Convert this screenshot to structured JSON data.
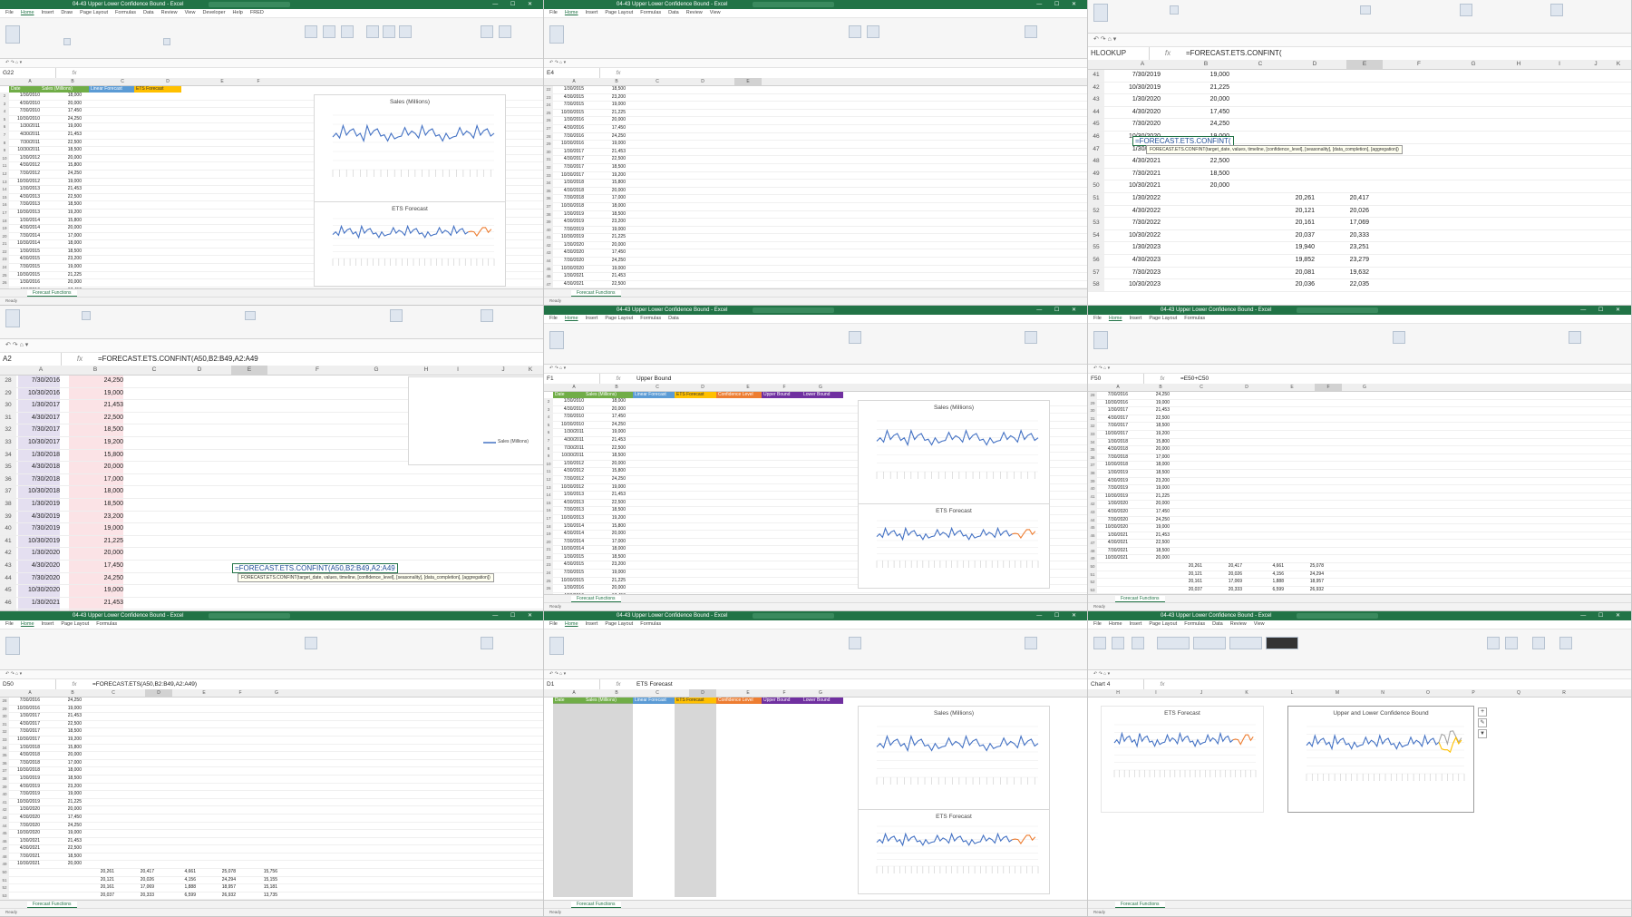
{
  "app": {
    "title": "04-43 Upper Lower Confidence Bound - Excel",
    "menu": [
      "File",
      "Home",
      "Insert",
      "Draw",
      "Page Layout",
      "Formulas",
      "Data",
      "Review",
      "View",
      "Developer",
      "Help",
      "FRED"
    ],
    "share_label": "Share",
    "sheet_tab": "Forecast Functions",
    "accent": "#217346"
  },
  "headers": {
    "date": "Date",
    "sales": "Sales (Millions)",
    "linear": "Linear Forecast",
    "ets": "ETS Forecast",
    "conf": "Confidence Level",
    "upper": "Upper Bound",
    "lower": "Lower Bound",
    "colors": {
      "date": "#70ad47",
      "sales": "#70ad47",
      "linear": "#5b9bd5",
      "ets": "#ffc000",
      "conf": "#ed7d31",
      "upper": "#7030a0",
      "lower": "#7030a0"
    }
  },
  "charts": {
    "sales_title": "Sales (Millions)",
    "ets_title": "ETS Forecast",
    "bound_title": "Upper and Lower Confidence Bound",
    "ets_title2": "ETS Forecast",
    "legend_sales": "Sales (Millions)"
  },
  "formulas": {
    "p3_namebox": "HLOOKUP",
    "p3_formula": "=FORECAST.ETS.CONFINT(",
    "p3_tooltip": "FORECAST.ETS.CONFINT(target_date, values, timeline, [confidence_level], [seasonality], [data_completion], [aggregation])",
    "p4_namebox": "A2",
    "p4_formula": "=FORECAST.ETS.CONFINT(A50,B2:B49,A2:A49",
    "p4_edit": "=FORECAST.ETS.CONFINT(A50,B2:B49,A2:A49",
    "p4_tooltip": "FORECAST.ETS.CONFINT(target_date, values, timeline, [confidence_level], [seasonality], [data_completion], [aggregation])",
    "p7_formula": "=FORECAST.ETS(A50,B2:B49,A2:A49)",
    "p8_formula": "ETS Forecast",
    "p6_formula": "=E50+C50",
    "p5_formula": "Upper Bound"
  },
  "p3_rows": [
    {
      "r": "41",
      "a": "7/30/2019",
      "b": "19,000",
      "c": "",
      "d": ""
    },
    {
      "r": "42",
      "a": "10/30/2019",
      "b": "21,225",
      "c": "",
      "d": ""
    },
    {
      "r": "43",
      "a": "1/30/2020",
      "b": "20,000",
      "c": "",
      "d": ""
    },
    {
      "r": "44",
      "a": "4/30/2020",
      "b": "17,450",
      "c": "",
      "d": ""
    },
    {
      "r": "45",
      "a": "7/30/2020",
      "b": "24,250",
      "c": "",
      "d": ""
    },
    {
      "r": "46",
      "a": "10/30/2020",
      "b": "19,000",
      "c": "",
      "d": ""
    },
    {
      "r": "47",
      "a": "1/30/2021",
      "b": "21,453",
      "c": "",
      "d": ""
    },
    {
      "r": "48",
      "a": "4/30/2021",
      "b": "22,500",
      "c": "",
      "d": ""
    },
    {
      "r": "49",
      "a": "7/30/2021",
      "b": "18,500",
      "c": "",
      "d": ""
    },
    {
      "r": "50",
      "a": "10/30/2021",
      "b": "20,000",
      "c": "",
      "d": ""
    },
    {
      "r": "51",
      "a": "1/30/2022",
      "b": "",
      "c": "20,261",
      "d": "20,417"
    },
    {
      "r": "52",
      "a": "4/30/2022",
      "b": "",
      "c": "20,121",
      "d": "20,026"
    },
    {
      "r": "53",
      "a": "7/30/2022",
      "b": "",
      "c": "20,161",
      "d": "17,069"
    },
    {
      "r": "54",
      "a": "10/30/2022",
      "b": "",
      "c": "20,037",
      "d": "20,333"
    },
    {
      "r": "55",
      "a": "1/30/2023",
      "b": "",
      "c": "19,940",
      "d": "23,251"
    },
    {
      "r": "56",
      "a": "4/30/2023",
      "b": "",
      "c": "19,852",
      "d": "23,279"
    },
    {
      "r": "57",
      "a": "7/30/2023",
      "b": "",
      "c": "20,081",
      "d": "19,632"
    },
    {
      "r": "58",
      "a": "10/30/2023",
      "b": "",
      "c": "20,036",
      "d": "22,035"
    }
  ],
  "p4_rows": [
    {
      "r": "28",
      "a": "7/30/2016",
      "b": "24,250",
      "c": "",
      "d": ""
    },
    {
      "r": "29",
      "a": "10/30/2016",
      "b": "19,000",
      "c": "",
      "d": ""
    },
    {
      "r": "30",
      "a": "1/30/2017",
      "b": "21,453",
      "c": "",
      "d": ""
    },
    {
      "r": "31",
      "a": "4/30/2017",
      "b": "22,500",
      "c": "",
      "d": ""
    },
    {
      "r": "32",
      "a": "7/30/2017",
      "b": "18,500",
      "c": "",
      "d": ""
    },
    {
      "r": "33",
      "a": "10/30/2017",
      "b": "19,200",
      "c": "",
      "d": ""
    },
    {
      "r": "34",
      "a": "1/30/2018",
      "b": "15,800",
      "c": "",
      "d": ""
    },
    {
      "r": "35",
      "a": "4/30/2018",
      "b": "20,000",
      "c": "",
      "d": ""
    },
    {
      "r": "36",
      "a": "7/30/2018",
      "b": "17,000",
      "c": "",
      "d": ""
    },
    {
      "r": "37",
      "a": "10/30/2018",
      "b": "18,000",
      "c": "",
      "d": ""
    },
    {
      "r": "38",
      "a": "1/30/2019",
      "b": "18,500",
      "c": "",
      "d": ""
    },
    {
      "r": "39",
      "a": "4/30/2019",
      "b": "23,200",
      "c": "",
      "d": ""
    },
    {
      "r": "40",
      "a": "7/30/2019",
      "b": "19,000",
      "c": "",
      "d": ""
    },
    {
      "r": "41",
      "a": "10/30/2019",
      "b": "21,225",
      "c": "",
      "d": ""
    },
    {
      "r": "42",
      "a": "1/30/2020",
      "b": "20,000",
      "c": "",
      "d": ""
    },
    {
      "r": "43",
      "a": "4/30/2020",
      "b": "17,450",
      "c": "",
      "d": ""
    },
    {
      "r": "44",
      "a": "7/30/2020",
      "b": "24,250",
      "c": "",
      "d": ""
    },
    {
      "r": "45",
      "a": "10/30/2020",
      "b": "19,000",
      "c": "",
      "d": ""
    },
    {
      "r": "46",
      "a": "1/30/2021",
      "b": "21,453",
      "c": "",
      "d": ""
    },
    {
      "r": "47",
      "a": "4/30/2021",
      "b": "22,500",
      "c": "",
      "d": ""
    },
    {
      "r": "48",
      "a": "7/30/2021",
      "b": "18,500",
      "c": "",
      "d": ""
    },
    {
      "r": "49",
      "a": "10/30/2021",
      "b": "20,000",
      "c": "",
      "d": ""
    },
    {
      "r": "50",
      "a": "1/30/2022",
      "b": "",
      "c": "20,261",
      "d": "20,417"
    },
    {
      "r": "51",
      "a": "4/30/2022",
      "b": "",
      "c": "20,121",
      "d": "20,026"
    },
    {
      "r": "52",
      "a": "7/30/2022",
      "b": "",
      "c": "20,161",
      "d": "17,069"
    },
    {
      "r": "53",
      "a": "10/30/2022",
      "b": "",
      "c": "20,037",
      "d": "20,333"
    },
    {
      "r": "54",
      "a": "1/30/2023",
      "b": "",
      "c": "19,940",
      "d": "23,251"
    }
  ],
  "p7_rows": [
    {
      "r": "50",
      "c": "20,261",
      "d": "20,417",
      "e": "4,661",
      "f": "25,078",
      "g": "15,756"
    },
    {
      "r": "51",
      "c": "20,121",
      "d": "20,026",
      "e": "4,156",
      "f": "24,294",
      "g": "15,155"
    },
    {
      "r": "52",
      "c": "20,161",
      "d": "17,069",
      "e": "1,888",
      "f": "18,957",
      "g": "15,181"
    },
    {
      "r": "53",
      "c": "20,037",
      "d": "20,333",
      "e": "6,599",
      "f": "26,932",
      "g": "13,735"
    },
    {
      "r": "54",
      "c": "19,940",
      "d": "23,251",
      "e": "3,968",
      "f": "27,219",
      "g": "19,283"
    },
    {
      "r": "55",
      "c": "19,852",
      "d": "23,279",
      "e": "332",
      "f": "23,611",
      "g": "22,947"
    },
    {
      "r": "56",
      "c": "20,081",
      "d": "19,632",
      "e": "516",
      "f": "20,148",
      "g": "19,116"
    },
    {
      "r": "57",
      "c": "20,036",
      "d": "22,035",
      "e": "709",
      "f": "22,744",
      "g": "21,326"
    }
  ],
  "chart_data": [
    {
      "type": "line",
      "title": "Sales (Millions)",
      "x": [
        "1/30/2010",
        "4/30/2010",
        "7/30/2010",
        "10/30/2010",
        "1/30/2011",
        "4/30/2011",
        "7/30/2011",
        "10/30/2011",
        "1/30/2012",
        "4/30/2012",
        "7/30/2012",
        "10/30/2012",
        "1/30/2013",
        "4/30/2013",
        "7/30/2013",
        "10/30/2013",
        "1/30/2014",
        "4/30/2014",
        "7/30/2014",
        "10/30/2014",
        "1/30/2015",
        "4/30/2015",
        "7/30/2015",
        "10/30/2015",
        "1/30/2016",
        "4/30/2016",
        "7/30/2016",
        "10/30/2016",
        "1/30/2017",
        "4/30/2017",
        "7/30/2017",
        "10/30/2017",
        "1/30/2018",
        "4/30/2018",
        "7/30/2018",
        "10/30/2018",
        "1/30/2019",
        "4/30/2019",
        "7/30/2019",
        "10/30/2019",
        "1/30/2020",
        "4/30/2020",
        "7/30/2020",
        "10/30/2020",
        "1/30/2021",
        "4/30/2021",
        "7/30/2021",
        "10/30/2021"
      ],
      "series": [
        {
          "name": "Sales (Millions)",
          "values": [
            18000,
            20000,
            17450,
            24250,
            19000,
            21453,
            22500,
            18500,
            20000,
            15800,
            24250,
            19000,
            21453,
            22500,
            18500,
            19200,
            15800,
            20000,
            17000,
            18000,
            18500,
            23200,
            19000,
            21225,
            20000,
            17450,
            24250,
            19000,
            21453,
            22500,
            18500,
            19200,
            15800,
            20000,
            17000,
            18000,
            18500,
            23200,
            19000,
            21225,
            20000,
            17450,
            24250,
            19000,
            21453,
            22500,
            18500,
            20000
          ]
        }
      ],
      "ylim": [
        0,
        30000
      ]
    },
    {
      "type": "line",
      "title": "ETS Forecast",
      "series": [
        {
          "name": "Sales (Millions)",
          "values": [
            18000,
            20000,
            17450,
            24250,
            19000,
            21453,
            22500,
            18500,
            20000,
            15800,
            24250,
            19000,
            21453,
            22500,
            18500,
            19200,
            15800,
            20000,
            17000,
            18000,
            18500,
            23200,
            19000,
            21225,
            20000,
            17450,
            24250,
            19000,
            21453,
            22500,
            18500,
            19200,
            15800,
            20000,
            17000,
            18000,
            18500,
            23200,
            19000,
            21225,
            20000,
            17450,
            24250,
            19000,
            21453,
            22500,
            18500,
            20000
          ]
        },
        {
          "name": "ETS Forecast",
          "values": [
            20417,
            20026,
            17069,
            20333,
            23251,
            23279,
            19632,
            22035
          ]
        }
      ],
      "ylim": [
        0,
        30000
      ]
    },
    {
      "type": "line",
      "title": "Upper and Lower Confidence Bound",
      "series": [
        {
          "name": "Sales (Millions)",
          "values": [
            18000,
            20000,
            17450,
            24250,
            19000,
            21453,
            22500,
            18500,
            20000,
            15800,
            24250,
            19000,
            21453,
            22500,
            18500,
            19200,
            15800,
            20000,
            17000,
            18000,
            18500,
            23200,
            19000,
            21225,
            20000,
            17450,
            24250,
            19000,
            21453,
            22500,
            18500,
            19200,
            15800,
            20000,
            17000,
            18000,
            18500,
            23200,
            19000,
            21225,
            20000,
            17450,
            24250,
            19000,
            21453,
            22500,
            18500,
            20000
          ]
        },
        {
          "name": "Upper Bound",
          "values": [
            25078,
            24294,
            18957,
            26932,
            27219,
            23611,
            20148,
            22744
          ]
        },
        {
          "name": "Lower Bound",
          "values": [
            15756,
            15155,
            15181,
            13735,
            19283,
            22947,
            19116,
            21326
          ]
        }
      ],
      "ylim": [
        0,
        30000
      ]
    }
  ]
}
